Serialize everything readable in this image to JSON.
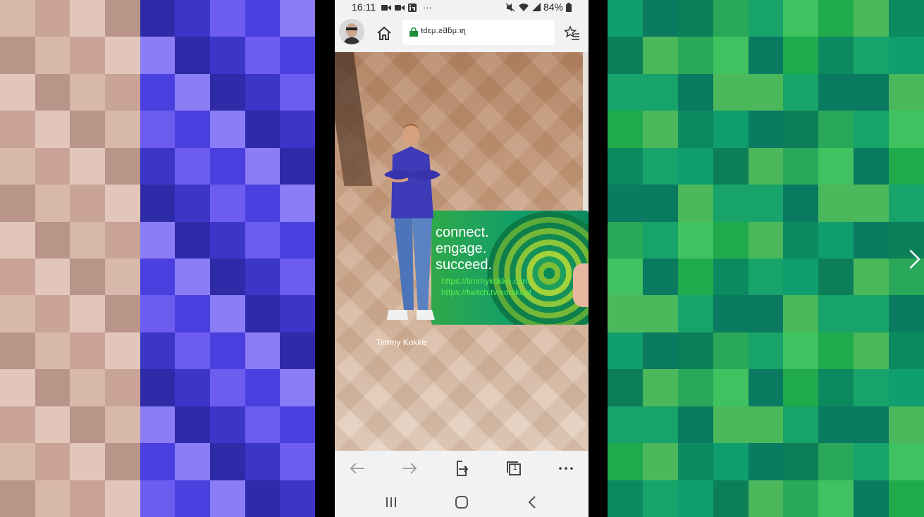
{
  "status_bar": {
    "time": "16:11",
    "more": "···",
    "battery": "84%"
  },
  "browser": {
    "url_display": "ŧԁεμ.ƨƋƃμ.ɐʅ"
  },
  "ar_scene": {
    "card": {
      "tagline": [
        "connect.",
        "engage.",
        "succeed."
      ],
      "links": [
        "https://timmykokke.com",
        "https://twitch.tv/sorskoot"
      ]
    },
    "person_label": "Timmy Kokke"
  },
  "icons": {
    "left_back": "back-arrow-icon",
    "right_forward": "forward-arrow-icon",
    "share": "share-icon",
    "tabs": "tabs-icon",
    "menu": "more-icon",
    "next_slide": "chevron-right-icon"
  },
  "tabs_count": "1",
  "colors": {
    "accent_green": "#119e6a",
    "link_green": "#56f050",
    "chrome_gray": "#f2f2f2"
  }
}
